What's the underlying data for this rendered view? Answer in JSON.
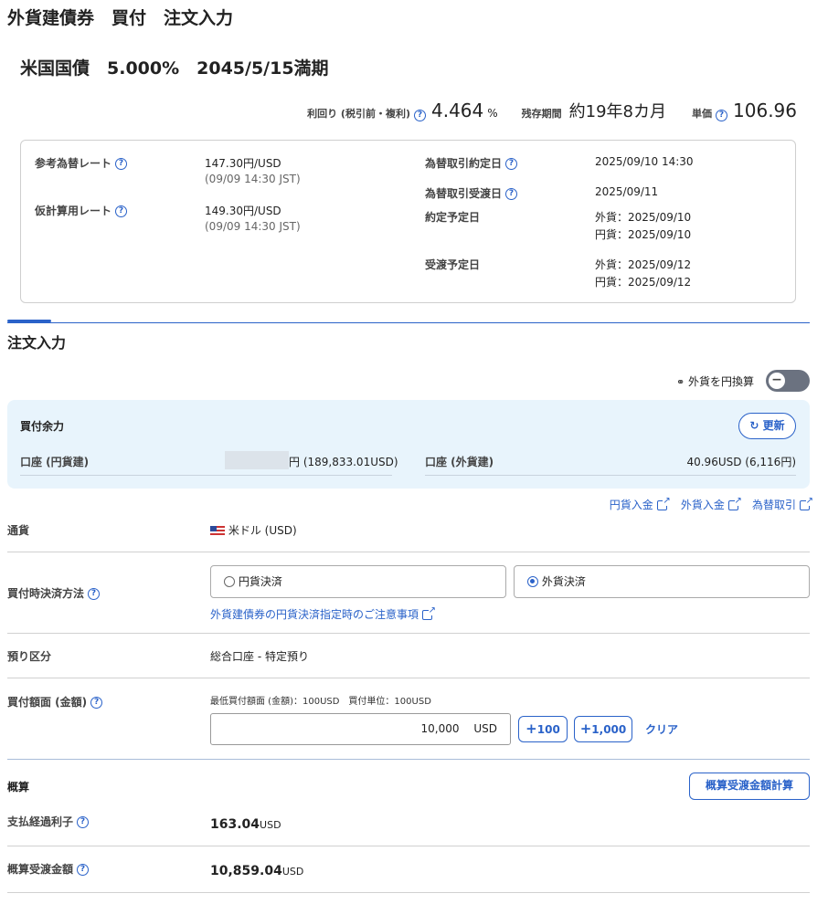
{
  "header": {
    "title": "外貨建債券　買付　注文入力",
    "bond_name": "米国国債　5.000%　2045/5/15満期",
    "yield_label": "利回り (税引前・複利)",
    "yield_value": "4.464",
    "yield_unit": "%",
    "remaining_label": "残存期間",
    "remaining_value": "約19年8カ月",
    "price_label": "単価",
    "price_value": "106.96"
  },
  "rates": {
    "ref_rate_label": "参考為替レート",
    "ref_rate_value": "147.30円/USD",
    "ref_rate_time": "(09/09 14:30 JST)",
    "calc_rate_label": "仮計算用レート",
    "calc_rate_value": "149.30円/USD",
    "calc_rate_time": "(09/09 14:30 JST)",
    "fx_trade_date_label": "為替取引約定日",
    "fx_trade_date_value": "2025/09/10 14:30",
    "fx_settle_date_label": "為替取引受渡日",
    "fx_settle_date_value": "2025/09/11",
    "trade_date_label": "約定予定日",
    "trade_date_fx": "外貨：2025/09/10",
    "trade_date_jpy": "円貨：2025/09/10",
    "settle_date_label": "受渡予定日",
    "settle_date_fx": "外貨：2025/09/12",
    "settle_date_jpy": "円貨：2025/09/12"
  },
  "order": {
    "section_title": "注文入力",
    "toggle_label": "外貨を円換算",
    "buying_power_title": "買付余力",
    "refresh_label": "更新",
    "jpy_account_label": "口座 (円貨建)",
    "jpy_account_value": "円 (189,833.01USD)",
    "fx_account_label": "口座 (外貨建)",
    "fx_account_value": "40.96USD (6,116円)",
    "links": [
      "円貨入金",
      "外貨入金",
      "為替取引"
    ],
    "currency_label": "通貨",
    "currency_value": "米ドル (USD)",
    "settlement_label": "買付時決済方法",
    "settlement_options": [
      "円貨決済",
      "外貨決済"
    ],
    "settlement_selected": "外貨決済",
    "settlement_note_link": "外貨建債券の円貨決済指定時のご注意事項",
    "custody_label": "預り区分",
    "custody_value": "総合口座 - 特定預り",
    "amount_label": "買付額面 (金額)",
    "amount_hint": "最低買付額面 (金額)：100USD　買付単位：100USD",
    "amount_value": "10,000",
    "amount_unit": "USD",
    "plus100_label": "100",
    "plus1000_label": "1,000",
    "clear_label": "クリア"
  },
  "estimate": {
    "title": "概算",
    "calc_button": "概算受渡金額計算",
    "accrued_label": "支払経過利子",
    "accrued_value": "163.04",
    "accrued_unit": "USD",
    "total_label": "概算受渡金額",
    "total_value": "10,859.04",
    "total_unit": "USD"
  },
  "colors": {
    "accent": "#2a62c9",
    "panel": "#e8f4fc",
    "toggle": "#6b7280"
  }
}
